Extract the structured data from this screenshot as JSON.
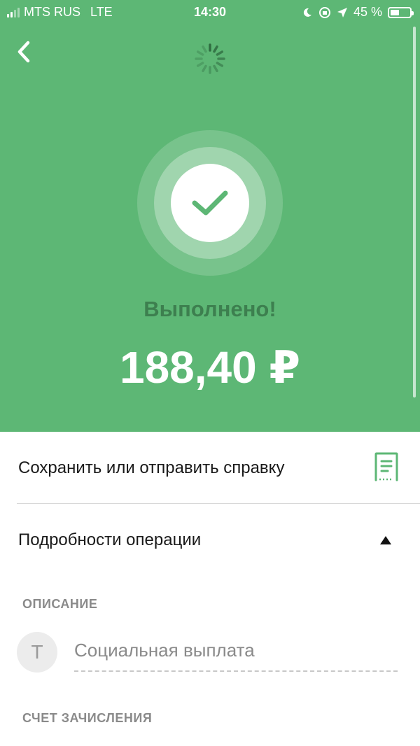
{
  "statusbar": {
    "carrier": "MTS RUS",
    "network": "LTE",
    "time": "14:30",
    "battery": "45 %",
    "icons": [
      "moon-icon",
      "orientation-lock-icon",
      "location-arrow-icon"
    ]
  },
  "header": {
    "back_icon": "chevron-left-icon",
    "spinner_icon": "loading-spinner-icon",
    "success_icon": "checkmark-icon",
    "status": "Выполнено!",
    "amount": "188,40 ₽"
  },
  "actions": {
    "save_label": "Сохранить или отправить справку",
    "save_icon": "document-receipt-icon",
    "details_label": "Подробности операции",
    "details_icon": "caret-up-icon"
  },
  "details": {
    "description_heading": "ОПИСАНИЕ",
    "avatar_letter": "Т",
    "description_value": "Социальная выплата",
    "account_heading": "СЧЕТ ЗАЧИСЛЕНИЯ"
  },
  "colors": {
    "brand_green": "#5db775",
    "status_text": "#3d7f4f",
    "receipt_icon": "#5db775"
  }
}
